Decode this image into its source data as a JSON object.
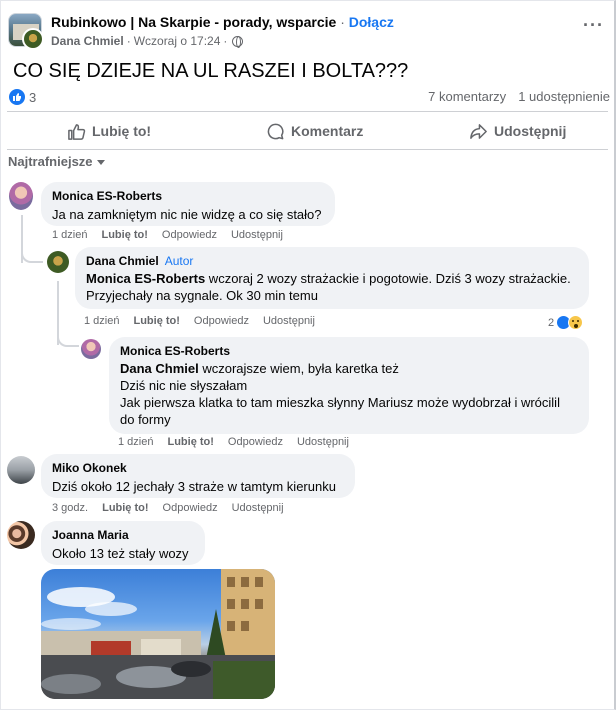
{
  "post": {
    "group_name": "Rubinkowo | Na Skarpie - porady, wsparcie",
    "separator": "·",
    "join_label": "Dołącz",
    "author": "Dana Chmiel",
    "time": "Wczoraj o 17:24",
    "visibility_icon": "globe-icon",
    "text": "CO SIĘ DZIEJE NA UL RASZEI I BOLTA???",
    "like_count": "3",
    "comments_count": "7 komentarzy",
    "shares_count": "1 udostępnienie"
  },
  "actions": {
    "like": "Lubię to!",
    "comment": "Komentarz",
    "share": "Udostępnij"
  },
  "sort_label": "Najtrafniejsze",
  "comments": [
    {
      "name": "Monica ES-Roberts",
      "text": "Ja na zamkniętym nic nie widzę a co się stało?",
      "time": "1 dzień",
      "like": "Lubię to!",
      "reply": "Odpowiedz",
      "share": "Udostępnij"
    },
    {
      "name": "Dana Chmiel",
      "badge": "Autor",
      "mention": "Monica ES-Roberts",
      "line1_rest": " wczoraj 2 wozy strażackie i pogotowie. Dziś 3 wozy strażackie.",
      "line2": "Przyjechały na sygnale. Ok 30 min temu",
      "time": "1 dzień",
      "like": "Lubię to!",
      "reply": "Odpowiedz",
      "share": "Udostępnij",
      "reaction_count": "2"
    },
    {
      "name": "Monica ES-Roberts",
      "mention": "Dana Chmiel",
      "line1_rest": " wczorajsze wiem, była karetka też",
      "line2": "Dziś nic nie słyszałam",
      "line3": "Jak pierwsza klatka to tam mieszka słynny Mariusz może wydobrzał i wrócilil",
      "line4": "do formy",
      "time": "1 dzień",
      "like": "Lubię to!",
      "reply": "Odpowiedz",
      "share": "Udostępnij"
    },
    {
      "name": "Miko Okonek",
      "text": "Dziś około 12 jechały 3 straże w tamtym kierunku",
      "time": "3 godz.",
      "like": "Lubię to!",
      "reply": "Odpowiedz",
      "share": "Udostępnij"
    },
    {
      "name": "Joanna Maria",
      "text": "Około 13 też stały wozy"
    }
  ],
  "colors": {
    "accent": "#1877f2",
    "bubble": "#f0f2f5",
    "secondary_text": "#65676b"
  }
}
